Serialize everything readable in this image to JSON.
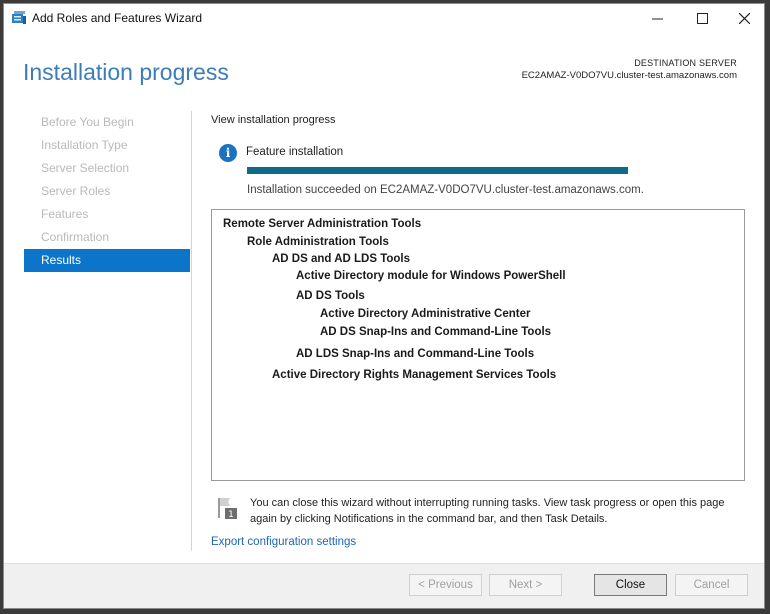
{
  "window": {
    "title": "Add Roles and Features Wizard",
    "controls": {
      "minimize": "—",
      "maximize": "☐",
      "close": "✕"
    }
  },
  "page": {
    "heading": "Installation progress",
    "destination_label": "DESTINATION SERVER",
    "destination_server": "EC2AMAZ-V0DO7VU.cluster-test.amazonaws.com"
  },
  "nav": {
    "items": [
      {
        "label": "Before You Begin",
        "active": false
      },
      {
        "label": "Installation Type",
        "active": false
      },
      {
        "label": "Server Selection",
        "active": false
      },
      {
        "label": "Server Roles",
        "active": false
      },
      {
        "label": "Features",
        "active": false
      },
      {
        "label": "Confirmation",
        "active": false
      },
      {
        "label": "Results",
        "active": true
      }
    ]
  },
  "progress": {
    "section_title": "View installation progress",
    "info_icon": "i",
    "feature_label": "Feature installation",
    "percent": 100,
    "status": "Installation succeeded on EC2AMAZ-V0DO7VU.cluster-test.amazonaws.com."
  },
  "results_tree": [
    {
      "label": "Remote Server Administration Tools",
      "level": 0
    },
    {
      "label": "Role Administration Tools",
      "level": 1
    },
    {
      "label": "AD DS and AD LDS Tools",
      "level": 2
    },
    {
      "label": "Active Directory module for Windows PowerShell",
      "level": 3
    },
    {
      "label": "AD DS Tools",
      "level": 3
    },
    {
      "label": "Active Directory Administrative Center",
      "level": 4
    },
    {
      "label": "AD DS Snap-Ins and Command-Line Tools",
      "level": 4
    },
    {
      "label": "AD LDS Snap-Ins and Command-Line Tools",
      "level": 3
    },
    {
      "label": "Active Directory Rights Management Services Tools",
      "level": 2
    }
  ],
  "note": {
    "badge": "1",
    "text": "You can close this wizard without interrupting running tasks. View task progress or open this page again by clicking Notifications in the command bar, and then Task Details."
  },
  "export_link": "Export configuration settings",
  "buttons": {
    "previous": "< Previous",
    "next": "Next >",
    "close": "Close",
    "cancel": "Cancel"
  },
  "colors": {
    "accent": "#0c74c9",
    "heading": "#3c7db8",
    "progress": "#0f6a8b",
    "link": "#1f66b0"
  }
}
